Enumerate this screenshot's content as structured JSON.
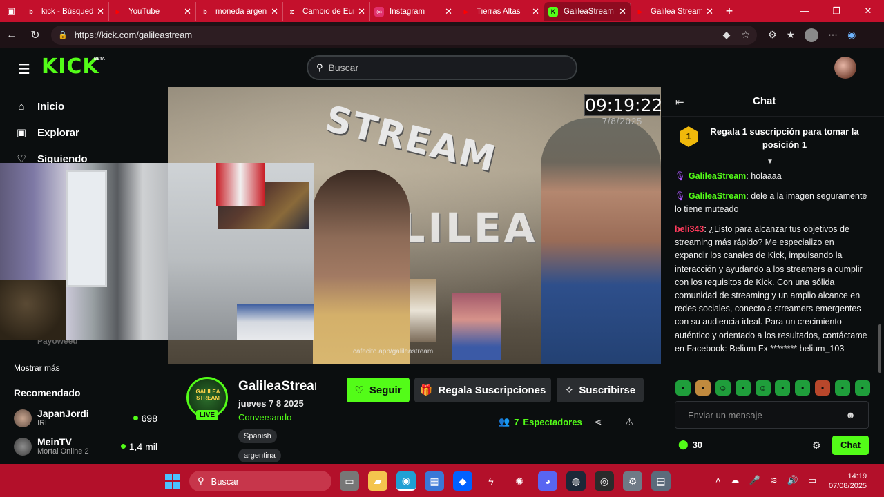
{
  "browser": {
    "tabs": [
      {
        "title": "kick - Búsqueda",
        "fav": "b",
        "fav_color": "#ffffff",
        "active": false
      },
      {
        "title": "YouTube",
        "fav": "▶",
        "fav_color": "#ff0000",
        "active": false
      },
      {
        "title": "moneda argentina",
        "fav": "b",
        "fav_color": "#ffffff",
        "active": false
      },
      {
        "title": "Cambio de Euro",
        "fav": "≋",
        "fav_color": "#ffffff",
        "active": false
      },
      {
        "title": "Instagram",
        "fav": "◎",
        "fav_color": "#e1306c",
        "active": false
      },
      {
        "title": "Tierras Altas",
        "fav": "▶",
        "fav_color": "#ff0000",
        "active": false
      },
      {
        "title": "GalileaStream",
        "fav": "K",
        "fav_color": "#53fc18",
        "active": true
      },
      {
        "title": "Galilea Stream",
        "fav": "▶",
        "fav_color": "#ff0000",
        "active": false
      }
    ],
    "url": "https://kick.com/galileastream"
  },
  "header": {
    "logo": "KICK",
    "beta": "BETA",
    "search_placeholder": "Buscar"
  },
  "sidebar": {
    "nav": [
      {
        "label": "Inicio",
        "icon": "home-icon"
      },
      {
        "label": "Explorar",
        "icon": "compass-icon"
      },
      {
        "label": "Siguiendo",
        "icon": "heart-icon"
      }
    ],
    "hidden_item": "Payoweed",
    "show_more": "Mostrar más",
    "recommended_title": "Recomendado",
    "recommended": [
      {
        "name": "JapanJordi",
        "category": "IRL",
        "viewers": "698"
      },
      {
        "name": "MeinTV",
        "category": "Mortal Online 2",
        "viewers": "1,4 mil"
      }
    ]
  },
  "video": {
    "clock": "09:19:22",
    "clock_date": "7/8/2025",
    "watermark": "cafecito.app/galileastream",
    "sign_top": "STREAM",
    "sign_bottom": "GALILEA"
  },
  "channel": {
    "avatar_text": "GALILEA STREAM",
    "live": "LIVE",
    "name": "GalileaStream",
    "title": "jueves 7 8 2025",
    "category": "Conversando",
    "tags": [
      "Spanish",
      "argentina"
    ],
    "follow": "Seguir",
    "gift": "Regala Suscripciones",
    "subscribe": "Suscribirse",
    "viewers_count": "7",
    "viewers_label": "Espectadores"
  },
  "chat": {
    "title": "Chat",
    "pin_rank": "1",
    "pin_text": "Regala 1 suscripción para tomar la posición 1",
    "messages": [
      {
        "user": "GalileaStream",
        "text": "holaaaa"
      },
      {
        "user": "GalileaStream",
        "text": "dele a la imagen seguramente lo tiene muteado"
      },
      {
        "user": "beli343",
        "text": "¿Listo para alcanzar tus objetivos de streaming más rápido? Me especializo en expandir los canales de Kick, impulsando la interacción y ayudando a los streamers a cumplir con los requisitos de Kick. Con una sólida comunidad de streaming y un amplio alcance en redes sociales, conecto a streamers emergentes con su audiencia ideal. Para un crecimiento auténtico y orientado a los resultados, contáctame en Facebook: Belium Fx ******** belium_103"
      }
    ],
    "input_placeholder": "Enviar un mensaje",
    "points": "30",
    "send": "Chat"
  },
  "taskbar": {
    "search": "Buscar",
    "time": "14:19",
    "date": "07/08/2025"
  }
}
